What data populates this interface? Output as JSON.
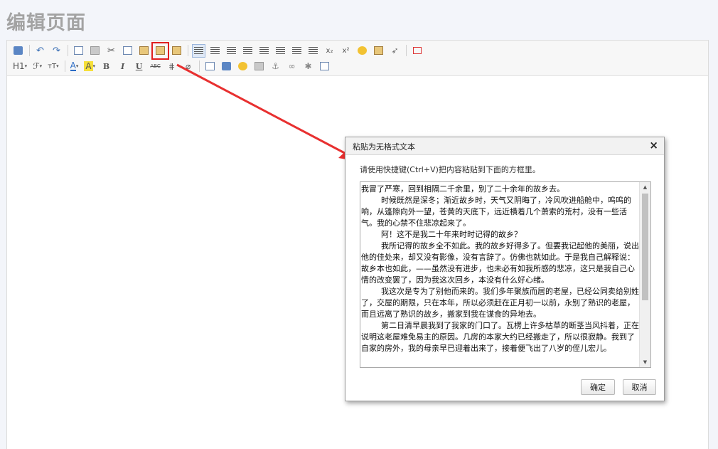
{
  "page": {
    "title": "编辑页面"
  },
  "toolbar": {
    "row2": {
      "heading": "H1",
      "font_family": "ℱ",
      "font_size": "тT",
      "font_color": "A",
      "bg_color": "A",
      "bold": "B",
      "italic": "I",
      "underline": "U",
      "strike": "ABC"
    },
    "colors": {
      "highlight_box": "#e02020",
      "arrow": "#e83030"
    }
  },
  "dialog": {
    "title": "粘贴为无格式文本",
    "close": "×",
    "tip": "请使用快捷键(Ctrl+V)把内容粘贴到下面的方框里。",
    "content": "我冒了严寒，回到相隔二千余里，别了二十余年的故乡去。\n        时候既然是深冬；渐近故乡时，天气又阴晦了，冷风吹进船舱中，呜呜的响，从篷隙向外一望，苍黄的天底下，远近横着几个萧索的荒村，没有一些活气。我的心禁不住悲凉起来了。\n        阿！这不是我二十年来时时记得的故乡？\n        我所记得的故乡全不如此。我的故乡好得多了。但要我记起他的美丽，说出他的佳处来，却又没有影像，没有言辞了。仿佛也就如此。于是我自己解释说：故乡本也如此，——虽然没有进步，也未必有如我所感的悲凉，这只是我自己心情的改变罢了，因为我这次回乡，本没有什么好心绪。\n        我这次是专为了别他而来的。我们多年聚族而居的老屋，已经公同卖给别姓了，交屋的期限，只在本年，所以必须赶在正月初一以前，永别了熟识的老屋，而且远离了熟识的故乡，搬家到我在谋食的异地去。\n        第二日清早晨我到了我家的门口了。瓦楞上许多枯草的断茎当风抖着，正在说明这老屋难免易主的原因。几房的本家大约已经搬走了，所以很寂静。我到了自家的房外，我的母亲早已迎着出来了，接着便飞出了八岁的侄儿宏儿。",
    "ok": "确定",
    "cancel": "取消",
    "scroll_up": "▲",
    "scroll_down": "▼"
  }
}
